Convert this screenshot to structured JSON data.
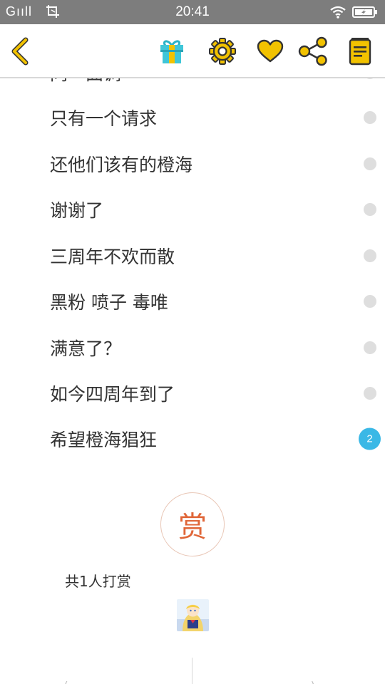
{
  "status_bar": {
    "signal": "Gııll",
    "time": "20:41"
  },
  "nav": {
    "icons": [
      "back-chevron-icon",
      "gift-icon",
      "gear-icon",
      "heart-icon",
      "share-icon",
      "book-icon"
    ],
    "accent_color": "#f2c200"
  },
  "list": {
    "partial_top_item": "同一曲调",
    "items": [
      {
        "text": "只有一个请求",
        "indicator": "dot"
      },
      {
        "text": "还他们该有的橙海",
        "indicator": "dot"
      },
      {
        "text": "谢谢了",
        "indicator": "dot"
      },
      {
        "text": "三周年不欢而散",
        "indicator": "dot"
      },
      {
        "text": "黑粉 喷子 毒唯",
        "indicator": "dot"
      },
      {
        "text": "满意了？",
        "indicator": "dot"
      },
      {
        "text": "如今四周年到了",
        "indicator": "dot"
      },
      {
        "text": "希望橙海猖狂",
        "indicator": "badge",
        "badge": "2"
      }
    ]
  },
  "reward": {
    "button_label": "赏",
    "count_text": "共1人打赏"
  },
  "colors": {
    "badge": "#3ab8e6",
    "reward": "#e06638",
    "dot": "#dedede"
  }
}
